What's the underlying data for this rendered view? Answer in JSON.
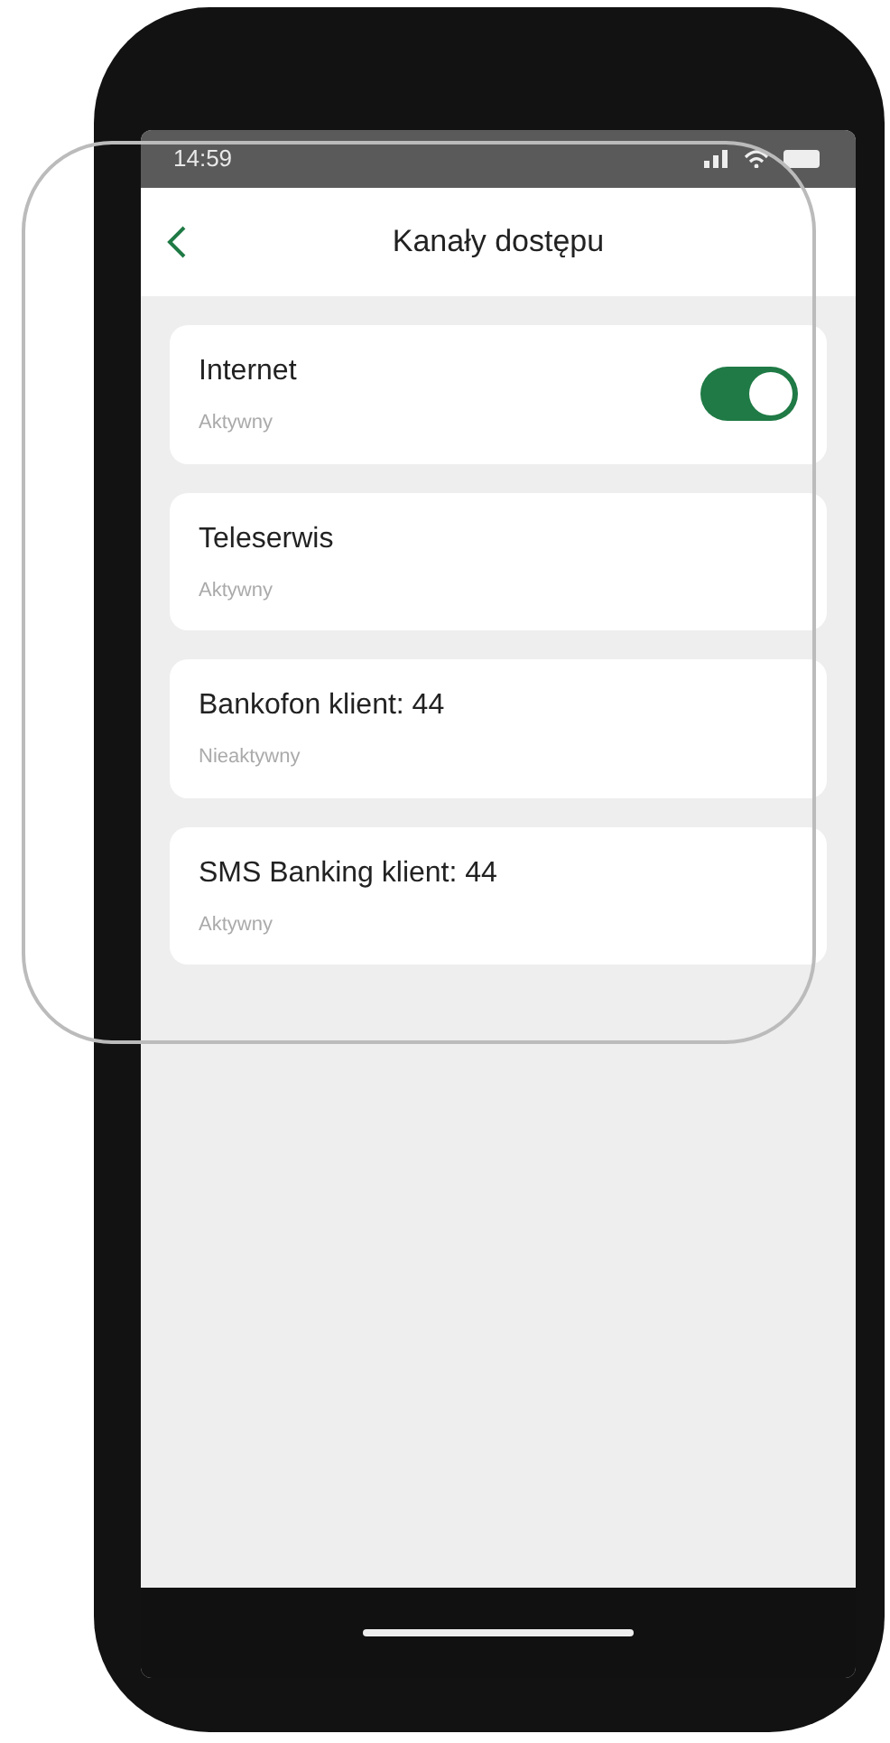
{
  "status_bar": {
    "time": "14:59"
  },
  "header": {
    "title": "Kanały dostępu"
  },
  "channels": [
    {
      "kind": "toggle",
      "name": "Internet",
      "status": "Aktywny",
      "on": true
    },
    {
      "kind": "plain",
      "name": "Teleserwis",
      "status": "Aktywny"
    },
    {
      "kind": "plain",
      "name": "Bankofon klient: 44",
      "status": "Nieaktywny"
    },
    {
      "kind": "plain",
      "name": "SMS Banking klient: 44",
      "status": "Aktywny"
    }
  ]
}
